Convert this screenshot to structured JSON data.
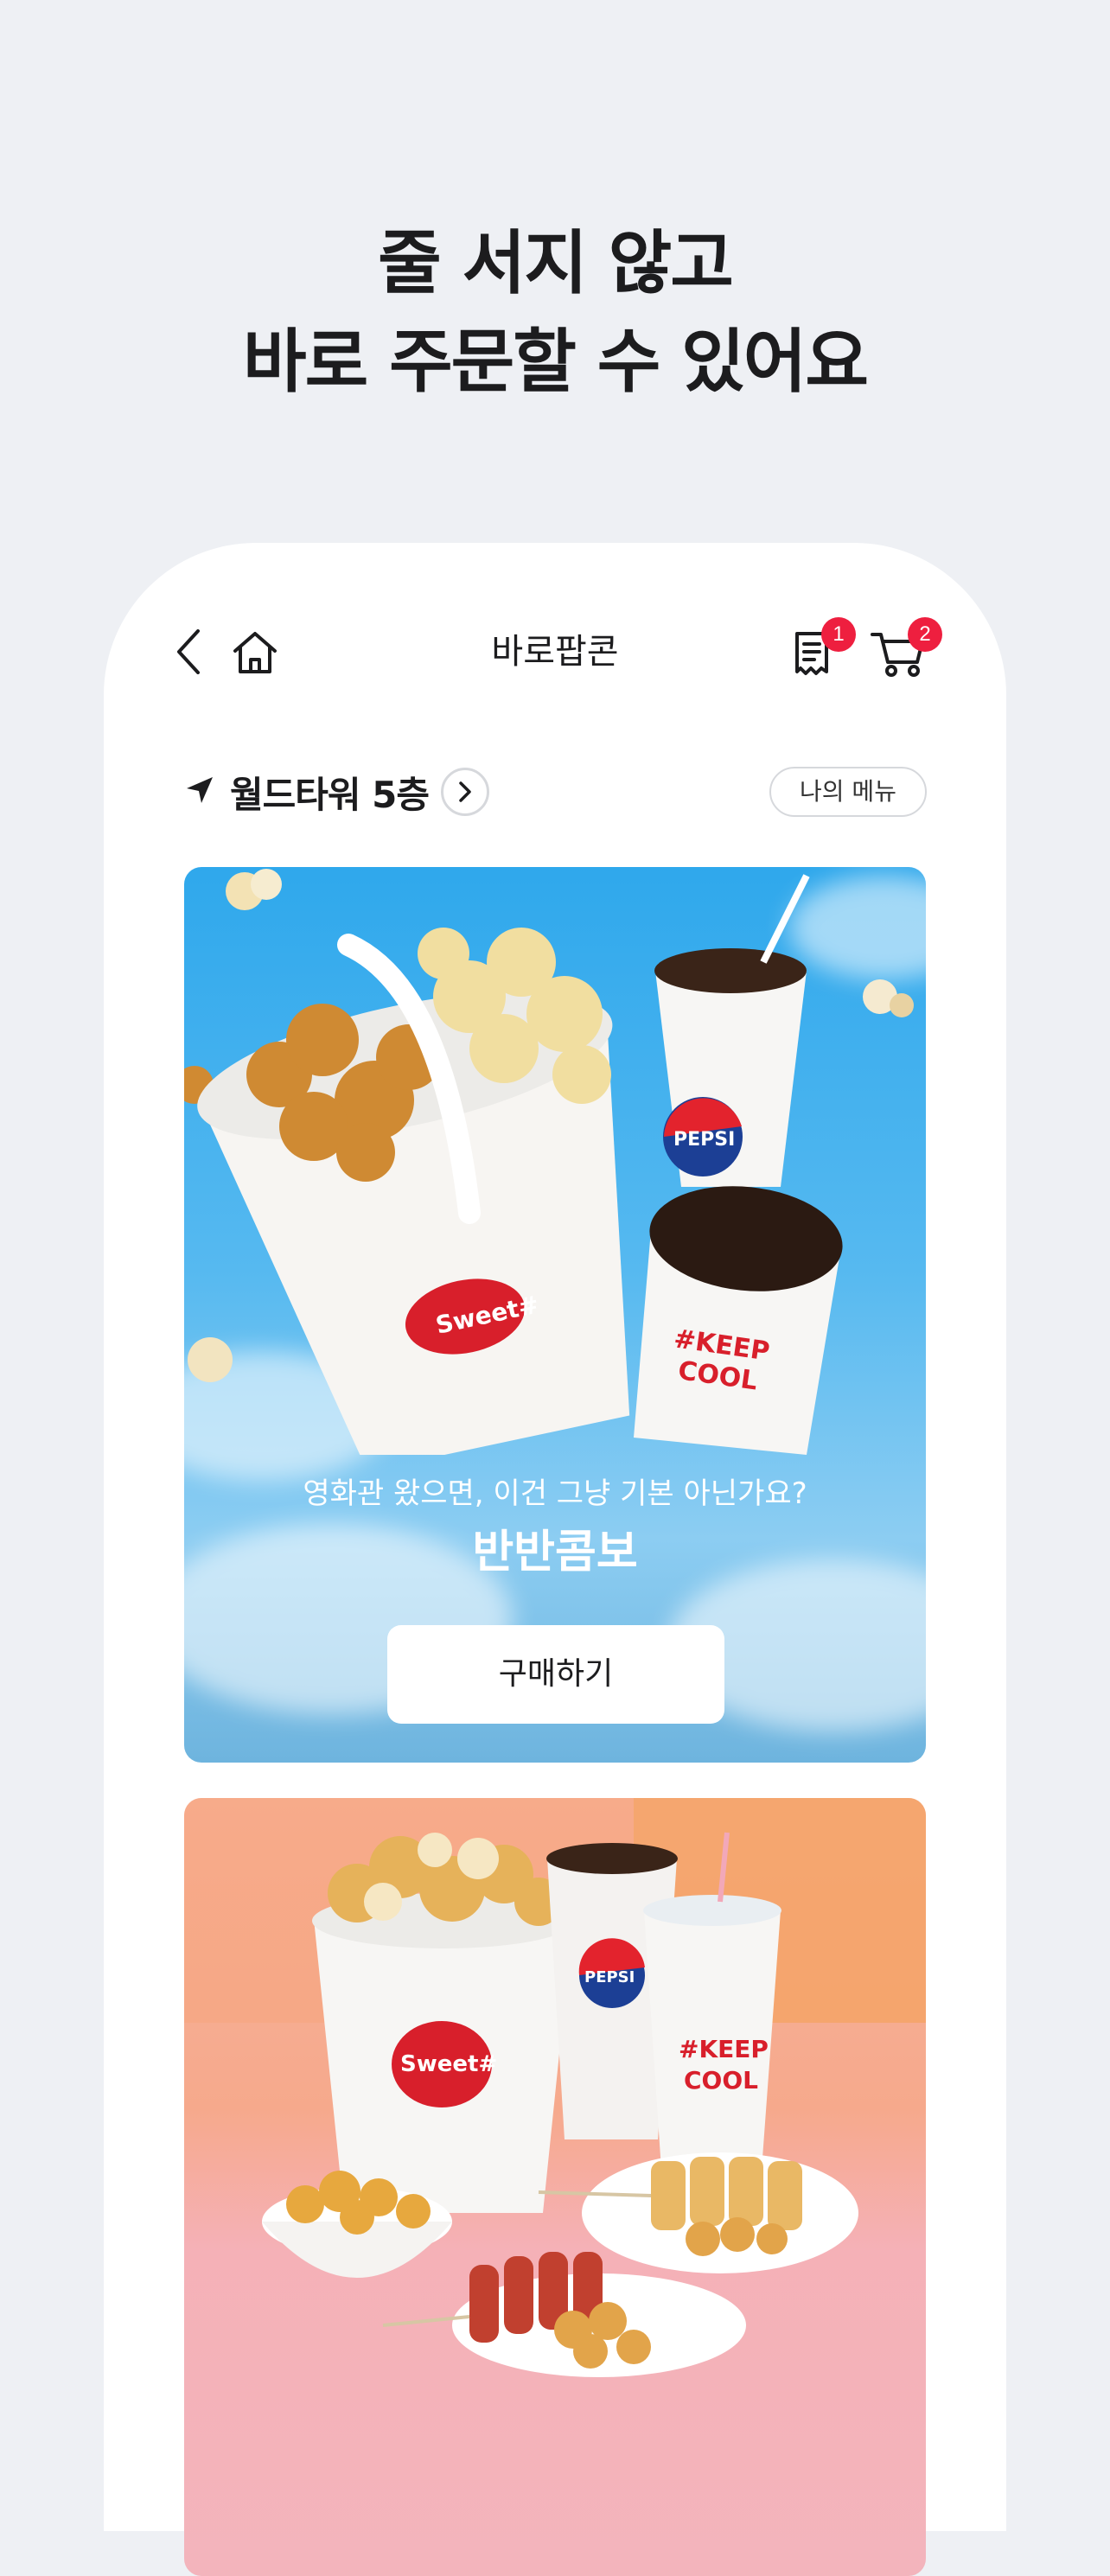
{
  "headline": {
    "line1": "줄 서지 않고",
    "line2": "바로 주문할 수 있어요"
  },
  "app_bar": {
    "title": "바로팝콘",
    "back_icon": "back-chevron-icon",
    "home_icon": "home-icon",
    "orders_icon": "receipt-icon",
    "orders_badge": "1",
    "cart_icon": "cart-icon",
    "cart_badge": "2"
  },
  "location": {
    "icon": "navigation-arrow-icon",
    "label": "월드타워 5층",
    "chevron_icon": "chevron-right-icon"
  },
  "my_menu_button": "나의 메뉴",
  "cards": [
    {
      "subtitle": "영화관 왔으면, 이건 그냥 기본 아닌가요?",
      "title": "반반콤보",
      "button": "구매하기",
      "bucket_logo": "Sweet#",
      "cup_logos": [
        "PEPSI",
        "#KEEP COOL"
      ]
    },
    {
      "bucket_logo": "Sweet#",
      "cup_logos": [
        "PEPSI",
        "#KEEP COOL"
      ]
    }
  ],
  "colors": {
    "accent_badge": "#ee1f3f",
    "background": "#eef0f4",
    "card1_sky": "#2fa8ec",
    "card2_peach": "#f7b39c"
  }
}
